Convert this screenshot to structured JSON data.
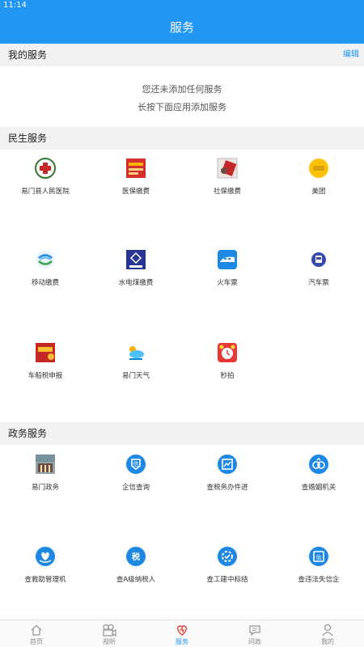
{
  "status": {
    "time": "11:14"
  },
  "header": {
    "title": "服务"
  },
  "my_services": {
    "title": "我的服务",
    "edit_label": "编辑",
    "empty_line1": "您还未添加任何服务",
    "empty_line2": "长按下面应用添加服务"
  },
  "livelihood": {
    "title": "民生服务",
    "items": [
      {
        "label": "易门县人民医院",
        "icon": "hospital-icon"
      },
      {
        "label": "医保缴费",
        "icon": "medical-insurance-icon"
      },
      {
        "label": "社保缴费",
        "icon": "social-security-icon"
      },
      {
        "label": "美团",
        "icon": "meituan-icon"
      },
      {
        "label": "移动缴费",
        "icon": "china-mobile-icon"
      },
      {
        "label": "水电煤缴费",
        "icon": "utility-bill-icon"
      },
      {
        "label": "火车票",
        "icon": "train-icon"
      },
      {
        "label": "汽车票",
        "icon": "bus-icon"
      },
      {
        "label": "车船税申报",
        "icon": "vehicle-tax-icon"
      },
      {
        "label": "易门天气",
        "icon": "weather-icon"
      },
      {
        "label": "秒拍",
        "icon": "alarm-clock-icon"
      }
    ]
  },
  "government": {
    "title": "政务服务",
    "items": [
      {
        "label": "易门政务",
        "icon": "government-building-icon"
      },
      {
        "label": "企信查询",
        "icon": "enterprise-credit-icon"
      },
      {
        "label": "查税务办件进",
        "icon": "tax-progress-icon"
      },
      {
        "label": "查婚姻机关",
        "icon": "marriage-icon"
      },
      {
        "label": "查救助管理机",
        "icon": "relief-icon"
      },
      {
        "label": "查A级纳税人",
        "icon": "a-taxpayer-icon"
      },
      {
        "label": "查工建中标结",
        "icon": "construction-bid-icon"
      },
      {
        "label": "查违法失信企",
        "icon": "dishonest-company-icon"
      }
    ]
  },
  "tabs": [
    {
      "label": "首页",
      "icon": "home-icon"
    },
    {
      "label": "视听",
      "icon": "video-camera-icon"
    },
    {
      "label": "服务",
      "icon": "heart-service-icon",
      "active": true
    },
    {
      "label": "问政",
      "icon": "message-icon"
    },
    {
      "label": "我的",
      "icon": "user-icon"
    }
  ],
  "colors": {
    "primary": "#2196f3",
    "section_bg": "#f2f2f2",
    "active_tab": "#2196f3",
    "inactive_tab": "#888888"
  }
}
